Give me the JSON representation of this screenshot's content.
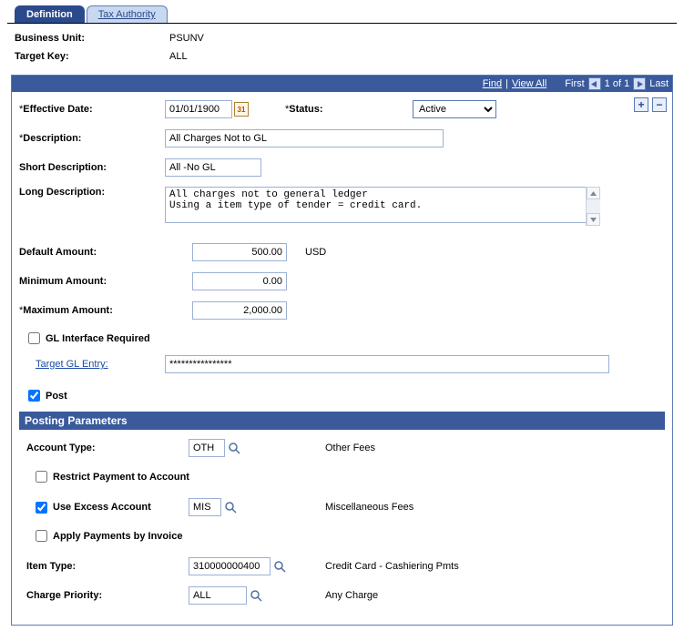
{
  "tabs": {
    "definition": "Definition",
    "tax_authority": "Tax Authority"
  },
  "header": {
    "business_unit_label": "Business Unit:",
    "business_unit_value": "PSUNV",
    "target_key_label": "Target Key:",
    "target_key_value": "ALL"
  },
  "scroll": {
    "find": "Find",
    "view_all": "View All",
    "first": "First",
    "page": "1 of 1",
    "last": "Last"
  },
  "form": {
    "effective_date_label": "Effective Date:",
    "effective_date_value": "01/01/1900",
    "status_label": "Status:",
    "status_value": "Active",
    "description_label": "Description:",
    "description_value": "All Charges Not to GL",
    "short_desc_label": "Short Description:",
    "short_desc_value": "All -No GL",
    "long_desc_label": "Long Description:",
    "long_desc_value": "All charges not to general ledger\nUsing a item type of tender = credit card.",
    "default_amount_label": "Default Amount:",
    "default_amount_value": "500.00",
    "currency": "USD",
    "minimum_amount_label": "Minimum Amount:",
    "minimum_amount_value": "0.00",
    "maximum_amount_label": "Maximum Amount:",
    "maximum_amount_value": "2,000.00",
    "gl_interface_label": "GL Interface Required",
    "target_gl_label": "Target GL Entry:",
    "target_gl_value": "****************",
    "post_label": "Post"
  },
  "posting": {
    "section_title": "Posting Parameters",
    "account_type_label": "Account Type:",
    "account_type_value": "OTH",
    "account_type_desc": "Other Fees",
    "restrict_payment_label": "Restrict Payment to Account",
    "use_excess_label": "Use Excess Account",
    "use_excess_value": "MIS",
    "use_excess_desc": "Miscellaneous Fees",
    "apply_payments_label": "Apply Payments by Invoice",
    "item_type_label": "Item Type:",
    "item_type_value": "310000000400",
    "item_type_desc": "Credit Card - Cashiering Pmts",
    "charge_priority_label": "Charge Priority:",
    "charge_priority_value": "ALL",
    "charge_priority_desc": "Any Charge"
  }
}
